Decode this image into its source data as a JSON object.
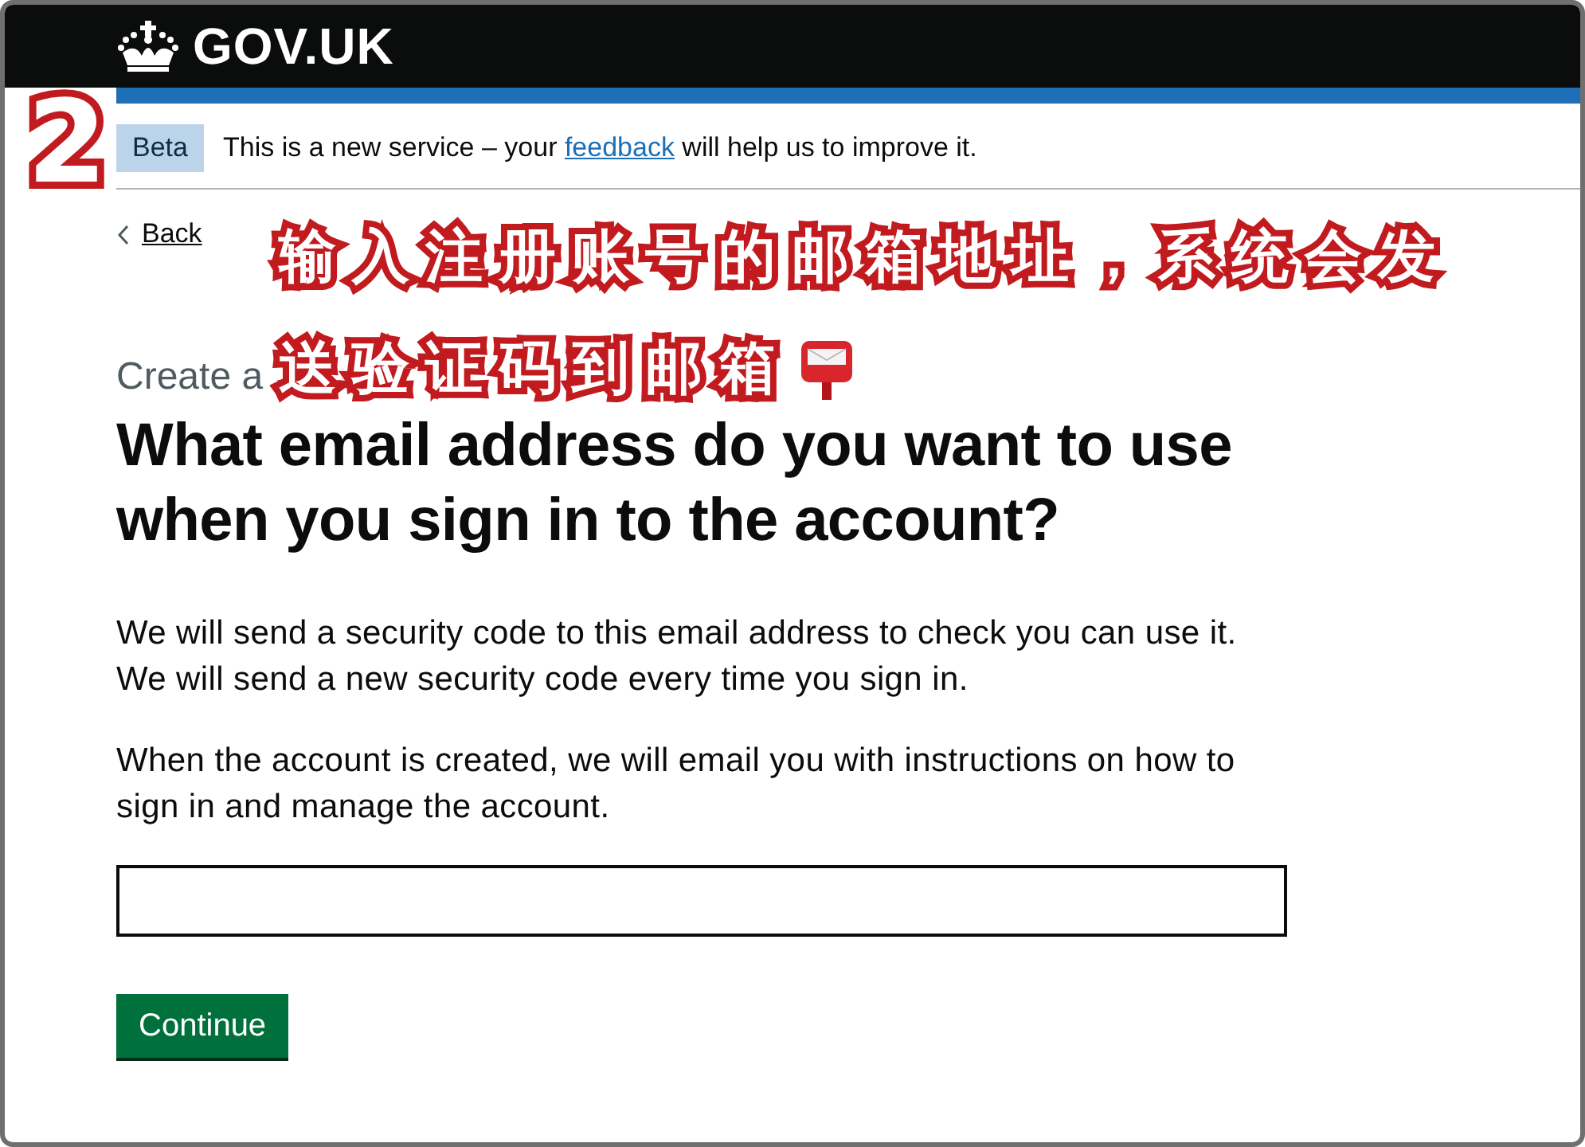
{
  "header": {
    "logo": "GOV.UK"
  },
  "phase_banner": {
    "tag": "Beta",
    "message_before": "This is a new service – your ",
    "link": "feedback",
    "message_after": " will help us to improve it."
  },
  "back_link": "Back",
  "caption": "Create a",
  "heading": "What email address do you want to use when you sign in to the account?",
  "paragraphs": [
    "We will send a security code to this email address to check you can use it. We will send a new security code every time you sign in.",
    "When the account is created, we will email you with instructions on how to sign in and manage the account."
  ],
  "button": "Continue",
  "annotation": {
    "step": "2",
    "lines": [
      "输入注册账号的邮箱地址，系统会发",
      "送验证码到邮箱"
    ]
  }
}
